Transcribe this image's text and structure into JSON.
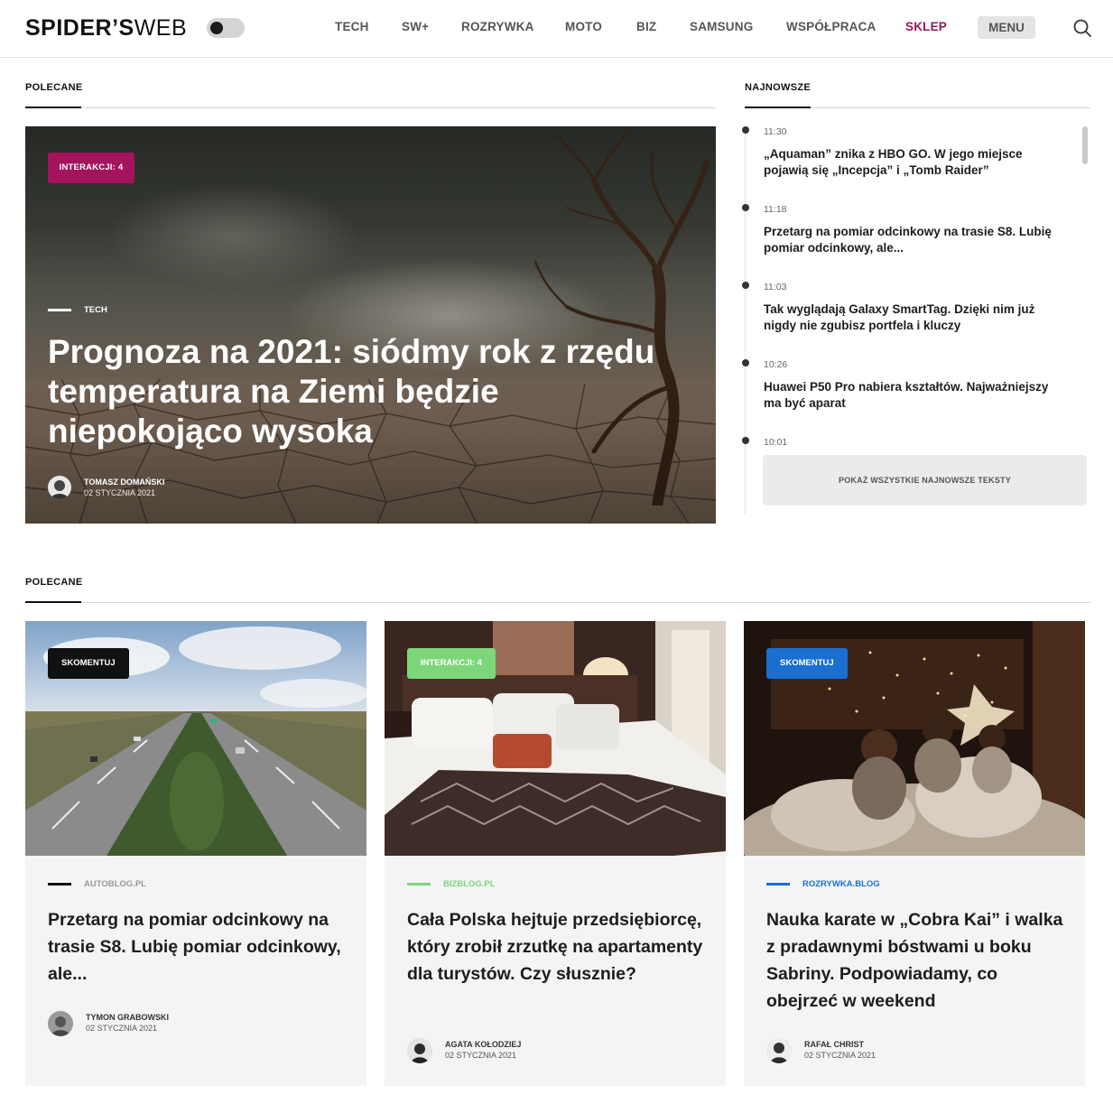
{
  "header": {
    "logo_bold": "SPIDER’S",
    "logo_light": "WEB",
    "nav": [
      "TECH",
      "SW+",
      "ROZRYWKA",
      "MOTO",
      "BIZ",
      "SAMSUNG",
      "WSPÓŁPRACA",
      "SKLEP"
    ],
    "menu_label": "MENU",
    "shop_color": "#8f1a5e"
  },
  "featured": {
    "section_title": "POLECANE",
    "badge": "INTERAKCJI: 4",
    "badge_color": "#a5125e",
    "category": "TECH",
    "title": "Prognoza na 2021: siódmy rok z rzędu temperatura na Ziemi będzie niepokojąco wysoka",
    "author": "TOMASZ DOMAŃSKI",
    "date": "02 STYCZNIA 2021"
  },
  "latest": {
    "section_title": "NAJNOWSZE",
    "items": [
      {
        "time": "11:30",
        "title": "„Aquaman” znika z HBO GO. W jego miejsce pojawią się „Incepcja” i „Tomb Raider”"
      },
      {
        "time": "11:18",
        "title": "Przetarg na pomiar odcinkowy na trasie S8. Lubię pomiar odcinkowy, ale..."
      },
      {
        "time": "11:03",
        "title": "Tak wyglądają Galaxy SmartTag. Dzięki nim już nigdy nie zgubisz portfela i kluczy"
      },
      {
        "time": "10:26",
        "title": "Huawei P50 Pro nabiera kształtów. Najważniejszy ma być aparat"
      },
      {
        "time": "10:01",
        "title": ""
      }
    ],
    "show_all": "POKAŻ WSZYSTKIE NAJNOWSZE TEKSTY"
  },
  "recommended": {
    "section_title": "POLECANE",
    "cards": [
      {
        "badge": "SKOMENTUJ",
        "badge_color": "#111111",
        "category": "AUTOBLOG.PL",
        "category_color": "#999999",
        "line_color": "#111111",
        "title": "Przetarg na pomiar odcinkowy na trasie S8. Lubię pomiar odcinkowy, ale...",
        "author": "TYMON GRABOWSKI",
        "date": "02 STYCZNIA 2021"
      },
      {
        "badge": "INTERAKCJI: 4",
        "badge_color": "#7ed67a",
        "category": "BIZBLOG.PL",
        "category_color": "#7ed67a",
        "line_color": "#7ed67a",
        "title": "Cała Polska hejtuje przedsiębiorcę, który zrobił zrzutkę na apartamenty dla turystów. Czy słusznie?",
        "author": "AGATA KOŁODZIEJ",
        "date": "02 STYCZNIA 2021"
      },
      {
        "badge": "SKOMENTUJ",
        "badge_color": "#1a6fd1",
        "category": "ROZRYWKA.BLOG",
        "category_color": "#1a6fd1",
        "line_color": "#1a6fd1",
        "title": "Nauka karate w „Cobra Kai” i walka z pradawnymi bóstwami u boku Sabriny. Podpowiadamy, co obejrzeć w weekend",
        "author": "RAFAŁ CHRIST",
        "date": "02 STYCZNIA 2021"
      }
    ]
  }
}
